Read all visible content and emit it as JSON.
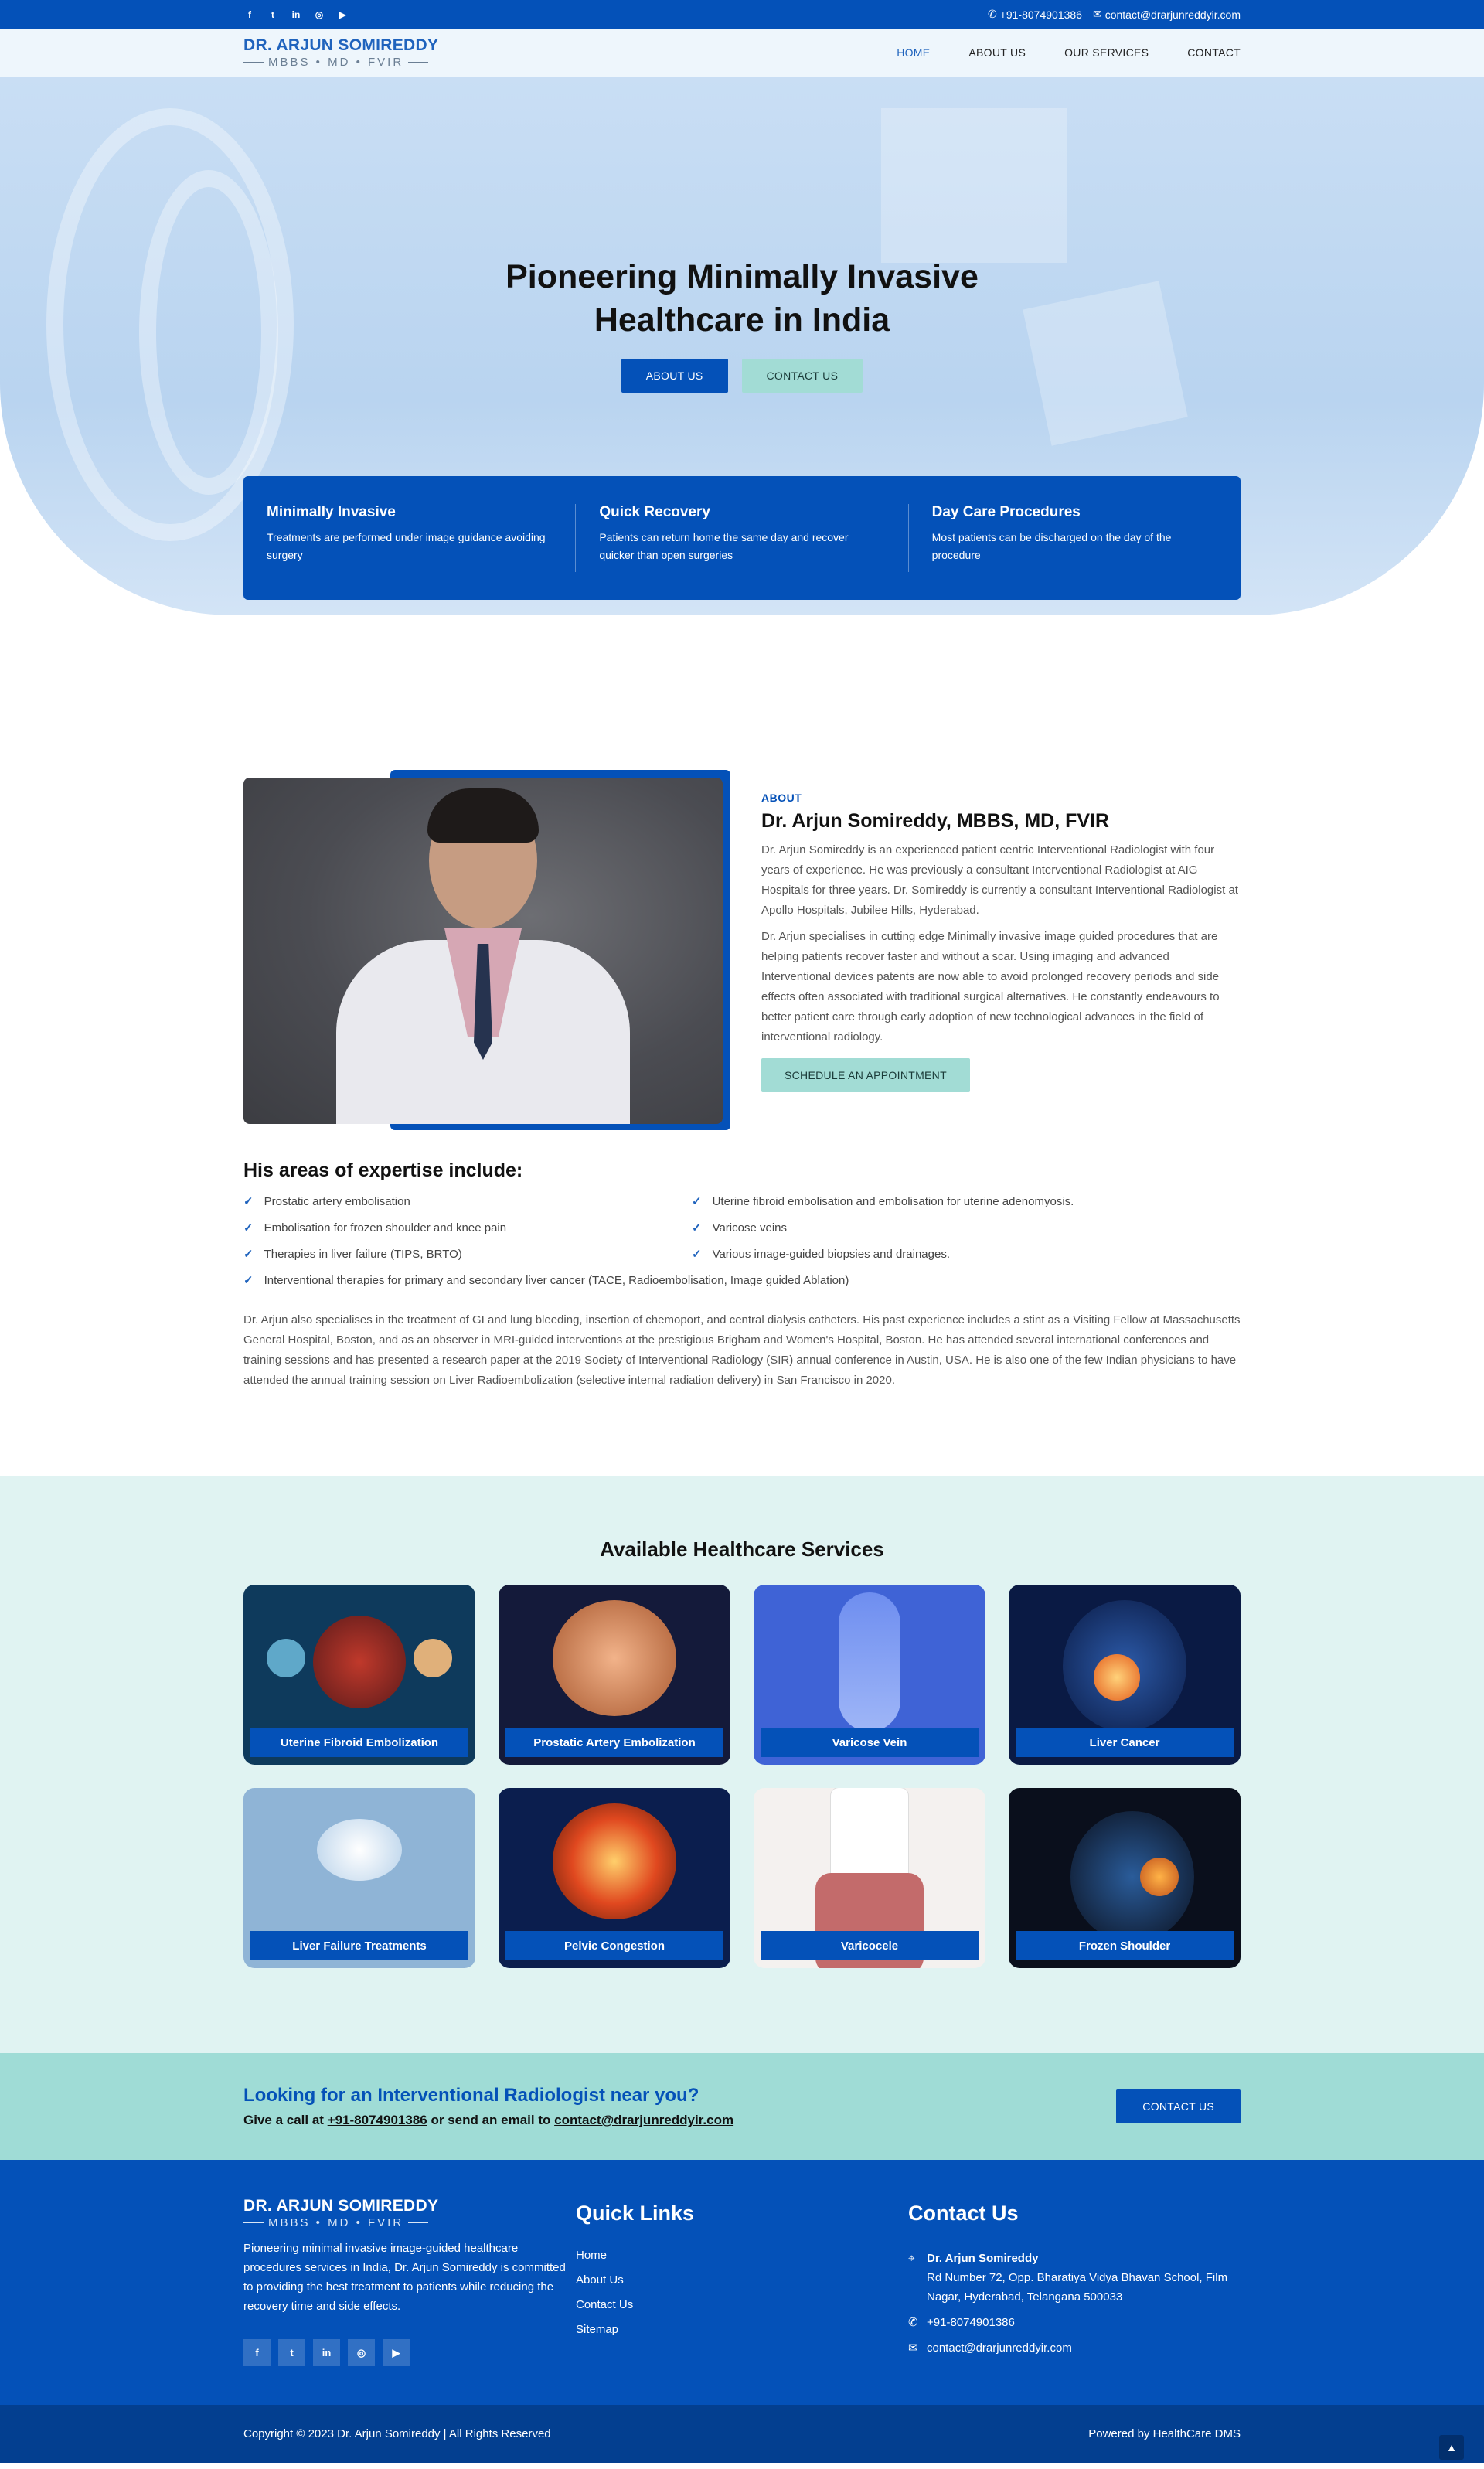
{
  "topbar": {
    "phone": "+91-8074901386",
    "email": "contact@drarjunreddyir.com"
  },
  "header": {
    "logo_name": "DR. ARJUN SOMIREDDY",
    "logo_sub": "MBBS • MD • FVIR",
    "nav": [
      "HOME",
      "ABOUT US",
      "OUR SERVICES",
      "CONTACT"
    ]
  },
  "hero": {
    "title": "Pioneering Minimally Invasive Healthcare in India",
    "about_btn": "ABOUT US",
    "contact_btn": "CONTACT US"
  },
  "features": [
    {
      "title": "Minimally Invasive",
      "text": "Treatments are performed under image guidance avoiding surgery"
    },
    {
      "title": "Quick Recovery",
      "text": "Patients can return home the same day and recover quicker than open surgeries"
    },
    {
      "title": "Day Care Procedures",
      "text": "Most patients can be discharged on the day of the procedure"
    }
  ],
  "about": {
    "eyebrow": "ABOUT",
    "title": "Dr. Arjun Somireddy, MBBS, MD, FVIR",
    "p1": "Dr. Arjun Somireddy is an experienced patient centric Interventional Radiologist with four years of experience. He was previously a consultant Interventional Radiologist at AIG Hospitals for three years. Dr. Somireddy is currently a consultant Interventional Radiologist at Apollo Hospitals, Jubilee Hills, Hyderabad.",
    "p2": "Dr. Arjun specialises in cutting edge Minimally invasive image guided procedures that are helping patients recover faster and without a scar. Using imaging and advanced Interventional devices patents are now able to avoid prolonged recovery periods and side effects often associated with traditional surgical alternatives. He constantly endeavours to better patient care through early adoption of new technological advances in the field of interventional radiology.",
    "btn": "SCHEDULE AN APPOINTMENT"
  },
  "expertise": {
    "title": "His areas of expertise include:",
    "items": [
      "Prostatic artery embolisation",
      "Uterine fibroid embolisation and embolisation for uterine adenomyosis.",
      "Embolisation for frozen shoulder and knee pain",
      "Varicose veins",
      "Therapies in liver failure (TIPS, BRTO)",
      "Various image-guided biopsies and drainages.",
      "Interventional therapies for primary and secondary liver cancer (TACE, Radioembolisation, Image guided Ablation)"
    ],
    "para": "Dr. Arjun also specialises in the treatment of GI and lung bleeding, insertion of chemoport, and central dialysis catheters. His past experience includes a stint as a Visiting Fellow at Massachusetts General Hospital, Boston, and as an observer in MRI-guided interventions at the prestigious Brigham and Women's Hospital, Boston. He has attended several international conferences and training sessions and has presented a research paper at the 2019 Society of Interventional Radiology (SIR) annual conference in Austin, USA. He is also one of the few Indian physicians to have attended the annual training session on Liver Radioembolization (selective internal radiation delivery) in San Francisco in 2020."
  },
  "services": {
    "title": "Available Healthcare Services",
    "items": [
      {
        "label": "Uterine Fibroid Embolization",
        "bg": "#0e3a5c"
      },
      {
        "label": "Prostatic Artery Embolization",
        "bg": "#141a3a"
      },
      {
        "label": "Varicose Vein",
        "bg": "#3f63d6"
      },
      {
        "label": "Liver Cancer",
        "bg": "#0a1a44"
      },
      {
        "label": "Liver Failure Treatments",
        "bg": "#8fb4d6"
      },
      {
        "label": "Pelvic Congestion",
        "bg": "#0b1e4e"
      },
      {
        "label": "Varicocele",
        "bg": "#f4f1ef"
      },
      {
        "label": "Frozen Shoulder",
        "bg": "#0a0f1c"
      }
    ]
  },
  "cta": {
    "title": "Looking for an Interventional Radiologist near you?",
    "pre": "Give a call at ",
    "phone": "+91-8074901386",
    "mid": " or send an email to ",
    "email": "contact@drarjunreddyir.com",
    "btn": "CONTACT US"
  },
  "footer": {
    "logo_name": "DR. ARJUN SOMIREDDY",
    "logo_sub": "MBBS • MD • FVIR",
    "desc": "Pioneering minimal invasive image-guided healthcare procedures services in India, Dr. Arjun Somireddy is committed to providing the best treatment to patients while reducing the recovery time and side effects.",
    "quick_title": "Quick Links",
    "links": [
      "Home",
      "About Us",
      "Contact Us",
      "Sitemap"
    ],
    "contact_title": "Contact Us",
    "contact_name": "Dr. Arjun Somireddy",
    "address": "Rd Number 72, Opp. Bharatiya Vidya Bhavan School, Film Nagar, Hyderabad, Telangana 500033",
    "phone": "+91-8074901386",
    "email": "contact@drarjunreddyir.com",
    "copyright": "Copyright © 2023 Dr. Arjun Somireddy | All Rights Reserved",
    "powered": "Powered by HealthCare DMS"
  },
  "icons": {
    "facebook": "facebook-icon",
    "twitter": "twitter-icon",
    "linkedin": "linkedin-icon",
    "instagram": "instagram-icon",
    "youtube": "youtube-icon",
    "phone": "phone-icon",
    "email": "email-icon",
    "location": "location-icon",
    "check": "check-icon",
    "up": "arrow-up-icon"
  },
  "colors": {
    "primary": "#0451b8",
    "teal": "#a2dcd5",
    "services_bg": "#e0f3f2",
    "cta_bg": "#9fdcd6"
  }
}
